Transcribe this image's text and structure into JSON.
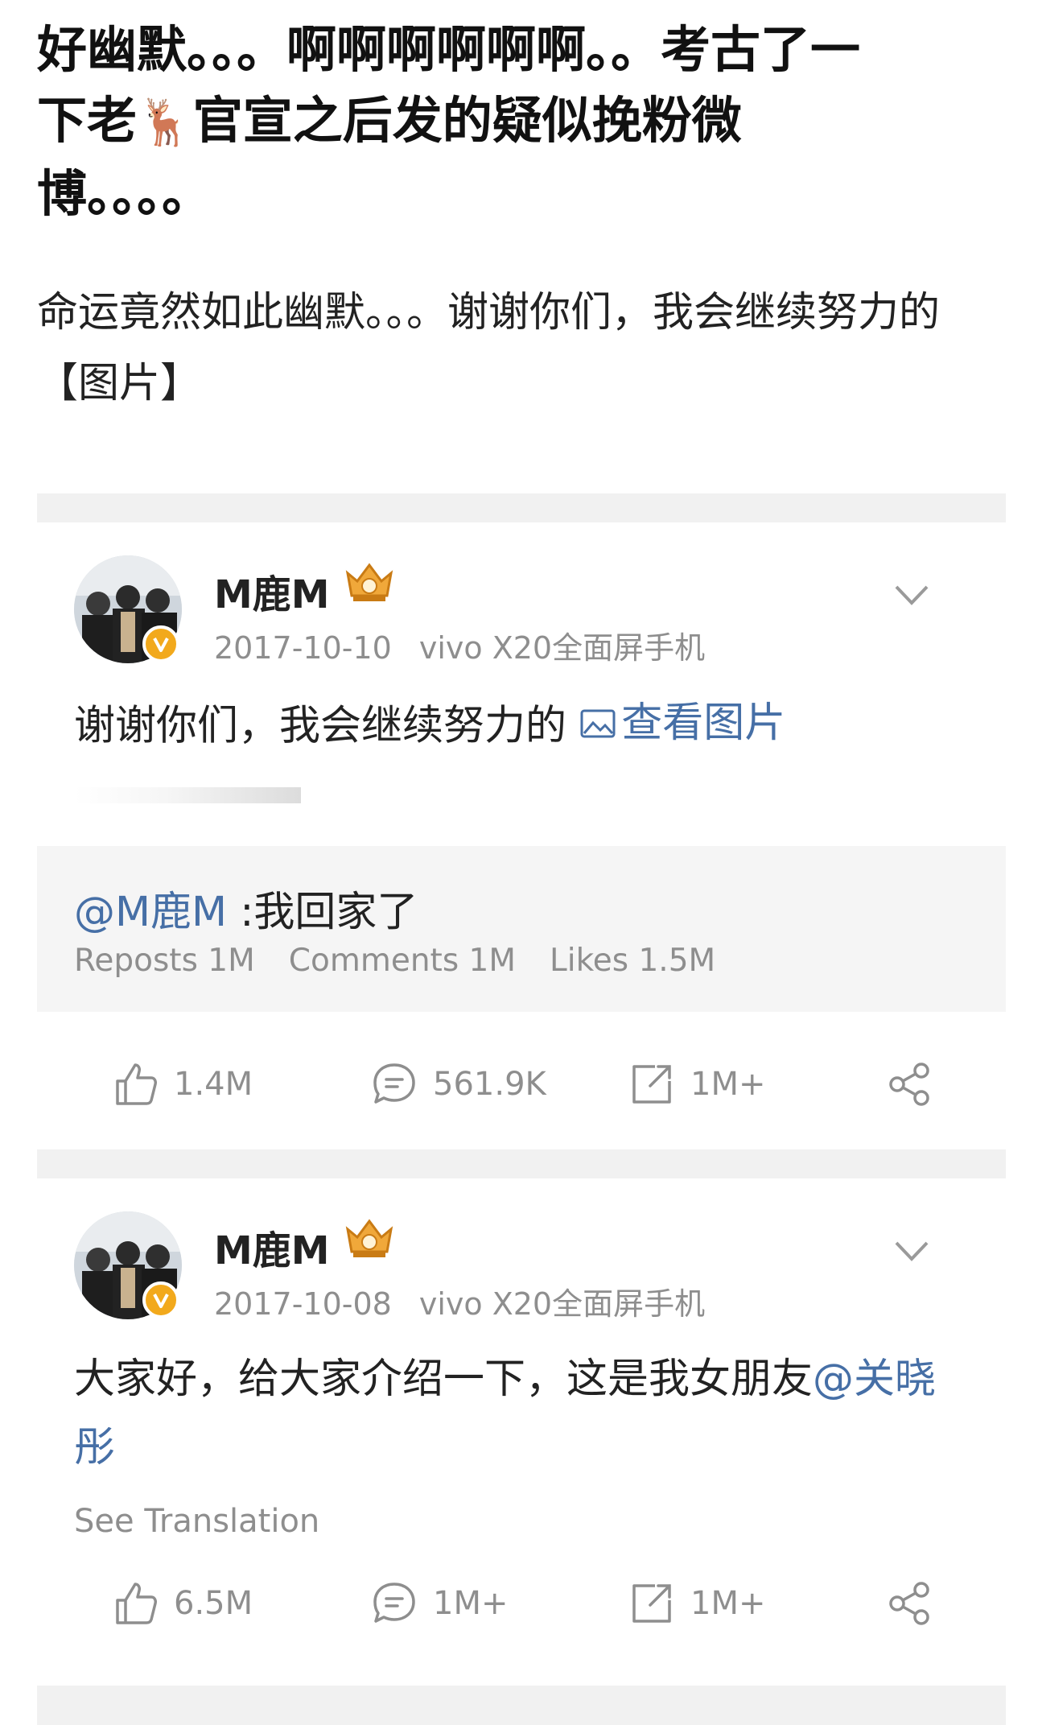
{
  "intro": {
    "line1": "好幽默。。。啊啊啊啊啊啊。。考古了一",
    "line2_a": "下老",
    "line2_emoji": "🦌",
    "line2_b": "官宣之后发的疑似挽粉微",
    "line3": "博。。。。",
    "quote": "命运竟然如此幽默。。。谢谢你们，我会继续努力的【图片】"
  },
  "posts": [
    {
      "username": "M鹿M",
      "date": "2017-10-10",
      "device": "vivo X20全面屏手机",
      "text": "谢谢你们，我会继续努力的",
      "image_link": "查看图片",
      "repost": {
        "mention": "@M鹿M",
        "text": " :我回家了",
        "reposts": "Reposts 1M",
        "comments": "Comments 1M",
        "likes": "Likes 1.5M"
      },
      "actions": {
        "like": "1.4M",
        "comment": "561.9K",
        "share": "1M+"
      }
    },
    {
      "username": "M鹿M",
      "date": "2017-10-08",
      "device": "vivo X20全面屏手机",
      "text": "大家好，给大家介绍一下，这是我女朋友",
      "mention": "@关晓彤",
      "translate": "See Translation",
      "actions": {
        "like": "6.5M",
        "comment": "1M+",
        "share": "1M+"
      }
    }
  ],
  "icons": [
    "chevron-down-icon",
    "like-icon",
    "comment-icon",
    "repost-icon",
    "share-icon",
    "image-icon",
    "verified-icon",
    "crown-badge-icon"
  ],
  "colors": {
    "link": "#466fa6",
    "verified": "#f2a91c",
    "meta": "#8e8e8e",
    "divider": "#f1f1f1"
  }
}
